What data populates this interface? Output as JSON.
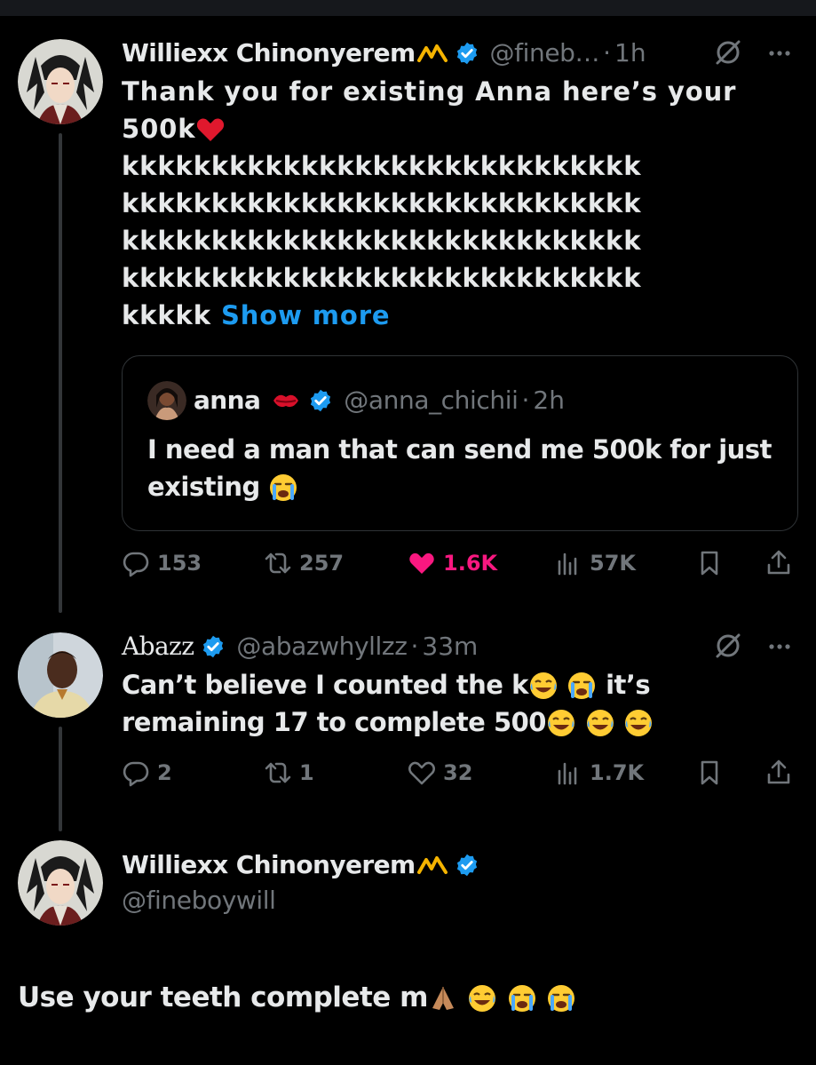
{
  "colors": {
    "background": "#000000",
    "text": "#e7e9ea",
    "muted": "#71767b",
    "accent": "#1d9bf0",
    "like": "#f91880",
    "border": "#2f3336"
  },
  "post1": {
    "name": "Williexx Chinonyerem",
    "crown_emoji": "crown-squiggle-icon",
    "handle": "@fineb…",
    "dot": "·",
    "time": "1h",
    "line1": "Thank you for existing Anna here’s your",
    "line2": "500k",
    "k_lines": [
      "kkkkkkkkkkkkkkkkkkkkkkkkkkkkk",
      "kkkkkkkkkkkkkkkkkkkkkkkkkkkkk",
      "kkkkkkkkkkkkkkkkkkkkkkkkkkkkk",
      "kkkkkkkkkkkkkkkkkkkkkkkkkkkkk"
    ],
    "k_last": "kkkkk",
    "show_more": "Show more",
    "quote": {
      "name": "anna",
      "handle": "@anna_chichii",
      "dot": "·",
      "time": "2h",
      "line1": "I need a man that can send me 500k for just",
      "line2": "existing"
    },
    "actions": {
      "replies": "153",
      "reposts": "257",
      "likes": "1.6K",
      "views": "57K"
    }
  },
  "post2": {
    "name": "Abazz",
    "handle": "@abazwhyllzz",
    "dot": "·",
    "time": "33m",
    "line1a": "Can’t believe I counted the k",
    "line1b": "it’s",
    "line2": "remaining 17 to complete 500",
    "actions": {
      "replies": "2",
      "reposts": "1",
      "likes": "32",
      "views": "1.7K"
    }
  },
  "post3": {
    "name": "Williexx Chinonyerem",
    "handle": "@fineboywill",
    "text": "Use your teeth complete m"
  }
}
